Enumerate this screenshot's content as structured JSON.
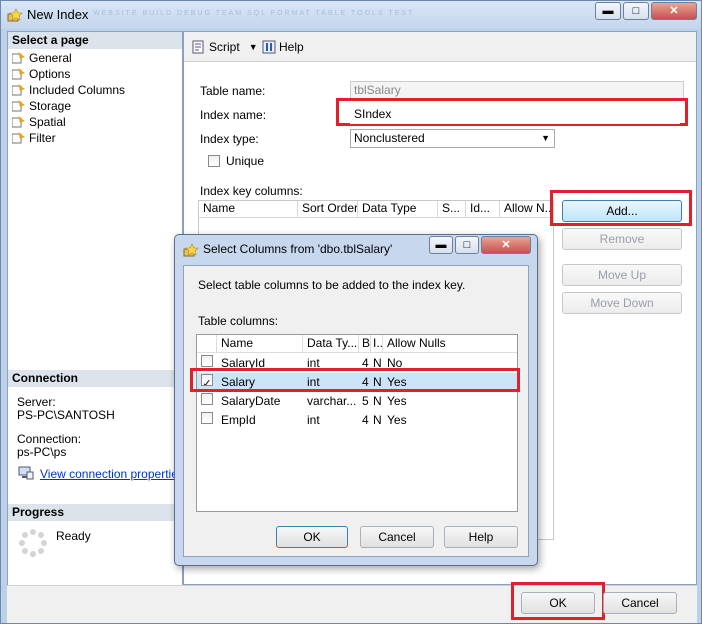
{
  "window": {
    "title": "New Index",
    "ghost_menu": "WEBSITE   BUILD   DEBUG   TEAM   SQL   FORMAT   TABLE   TOOLS   TEST"
  },
  "left": {
    "select_page_header": "Select a page",
    "pages": [
      "General",
      "Options",
      "Included Columns",
      "Storage",
      "Spatial",
      "Filter"
    ],
    "connection_header": "Connection",
    "server_label": "Server:",
    "server_value": "PS-PC\\SANTOSH",
    "connection_label": "Connection:",
    "connection_value": "ps-PC\\ps",
    "view_props_link": "View connection properties",
    "progress_header": "Progress",
    "progress_status": "Ready"
  },
  "toolbar": {
    "script_label": "Script",
    "help_label": "Help"
  },
  "form": {
    "table_name_label": "Table name:",
    "table_name_value": "tblSalary",
    "index_name_label": "Index name:",
    "index_name_value": "SIndex",
    "index_type_label": "Index type:",
    "index_type_value": "Nonclustered",
    "unique_label": "Unique",
    "key_columns_label": "Index key columns:",
    "key_columns_headers": [
      "Name",
      "Sort Order",
      "Data Type",
      "S...",
      "Id...",
      "Allow N..."
    ]
  },
  "side_buttons": {
    "add": "Add...",
    "remove": "Remove",
    "move_up": "Move Up",
    "move_down": "Move Down"
  },
  "bottom": {
    "ok": "OK",
    "cancel": "Cancel"
  },
  "dialog": {
    "title": "Select Columns from 'dbo.tblSalary'",
    "instruction": "Select table columns to be added to the index key.",
    "table_columns_label": "Table columns:",
    "headers": [
      "Name",
      "Data Ty...",
      "B",
      "I...",
      "Allow Nulls"
    ],
    "rows": [
      {
        "checked": false,
        "name": "SalaryId",
        "type": "int",
        "b": "4",
        "i": "N",
        "nulls": "No"
      },
      {
        "checked": true,
        "name": "Salary",
        "type": "int",
        "b": "4",
        "i": "N",
        "nulls": "Yes"
      },
      {
        "checked": false,
        "name": "SalaryDate",
        "type": "varchar...",
        "b": "5",
        "i": "N",
        "nulls": "Yes"
      },
      {
        "checked": false,
        "name": "EmpId",
        "type": "int",
        "b": "4",
        "i": "N",
        "nulls": "Yes"
      }
    ],
    "ok": "OK",
    "cancel": "Cancel",
    "help": "Help"
  },
  "colors": {
    "highlight": "#e0202c",
    "selected_row": "#cce4f7",
    "link": "#0033cc"
  }
}
